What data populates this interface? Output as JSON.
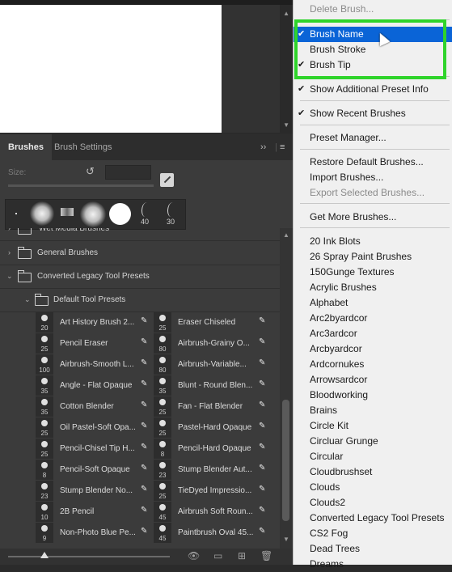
{
  "panel": {
    "tabs": [
      "Brushes",
      "Brush Settings"
    ],
    "size_label": "Size:",
    "recent_labels": [
      "40",
      "30"
    ]
  },
  "tree": [
    {
      "label": "Wet Media Brushes",
      "indent": 0
    },
    {
      "label": "General Brushes",
      "indent": 0
    },
    {
      "label": "Converted Legacy Tool Presets",
      "indent": 0
    },
    {
      "label": "Default Tool Presets",
      "indent": 1
    }
  ],
  "presets": [
    {
      "name": "Art History Brush 2...",
      "size": "20"
    },
    {
      "name": "Eraser Chiseled",
      "size": "25"
    },
    {
      "name": "Pencil Eraser",
      "size": "25"
    },
    {
      "name": "Airbrush-Grainy O...",
      "size": "80"
    },
    {
      "name": "Airbrush-Smooth L...",
      "size": "100"
    },
    {
      "name": "Airbrush-Variable...",
      "size": "80"
    },
    {
      "name": "Angle - Flat Opaque",
      "size": "35"
    },
    {
      "name": "Blunt - Round Blen...",
      "size": "35"
    },
    {
      "name": "Cotton Blender",
      "size": "35"
    },
    {
      "name": "Fan - Flat Blender",
      "size": "25"
    },
    {
      "name": "Oil Pastel-Soft Opa...",
      "size": "25"
    },
    {
      "name": "Pastel-Hard Opaque",
      "size": "25"
    },
    {
      "name": "Pencil-Chisel Tip H...",
      "size": "25"
    },
    {
      "name": "Pencil-Hard Opaque",
      "size": "8"
    },
    {
      "name": "Pencil-Soft Opaque",
      "size": "8"
    },
    {
      "name": "Stump Blender Aut...",
      "size": "23"
    },
    {
      "name": "Stump Blender No...",
      "size": "23"
    },
    {
      "name": "TieDyed Impressio...",
      "size": "25"
    },
    {
      "name": "2B Pencil",
      "size": "10"
    },
    {
      "name": "Airbrush Soft Roun...",
      "size": "45"
    },
    {
      "name": "Non-Photo Blue Pe...",
      "size": "9"
    },
    {
      "name": "Paintbrush Oval 45...",
      "size": "45"
    }
  ],
  "menu": {
    "items": [
      {
        "label": "Delete Brush...",
        "disabled": true
      },
      {
        "label": "Brush Name",
        "checked": true,
        "selected": true
      },
      {
        "label": "Brush Stroke"
      },
      {
        "label": "Brush Tip",
        "checked": true
      },
      {
        "label": "Show Additional Preset Info",
        "checked": true
      },
      {
        "label": "Show Recent Brushes",
        "checked": true
      },
      {
        "label": "Preset Manager..."
      },
      {
        "label": "Restore Default Brushes..."
      },
      {
        "label": "Import Brushes..."
      },
      {
        "label": "Export Selected Brushes...",
        "disabled": true
      },
      {
        "label": "Get More Brushes..."
      },
      {
        "label": "20 Ink Blots"
      },
      {
        "label": "26 Spray Paint Brushes"
      },
      {
        "label": "150Gunge Textures"
      },
      {
        "label": "Acrylic Brushes"
      },
      {
        "label": "Alphabet"
      },
      {
        "label": "Arc2byardcor"
      },
      {
        "label": "Arc3ardcor"
      },
      {
        "label": "Arcbyardcor"
      },
      {
        "label": "Ardcornukes"
      },
      {
        "label": "Arrowsardcor"
      },
      {
        "label": "Bloodworking"
      },
      {
        "label": "Brains"
      },
      {
        "label": "Circle Kit"
      },
      {
        "label": "Circluar Grunge"
      },
      {
        "label": "Circular"
      },
      {
        "label": "Cloudbrushset"
      },
      {
        "label": "Clouds"
      },
      {
        "label": "Clouds2"
      },
      {
        "label": "Converted Legacy Tool Presets"
      },
      {
        "label": "CS2 Fog"
      },
      {
        "label": "Dead Trees"
      },
      {
        "label": "Dreams"
      }
    ]
  },
  "colors": {
    "accent": "#0a64d7",
    "highlight": "#2fd42b"
  }
}
